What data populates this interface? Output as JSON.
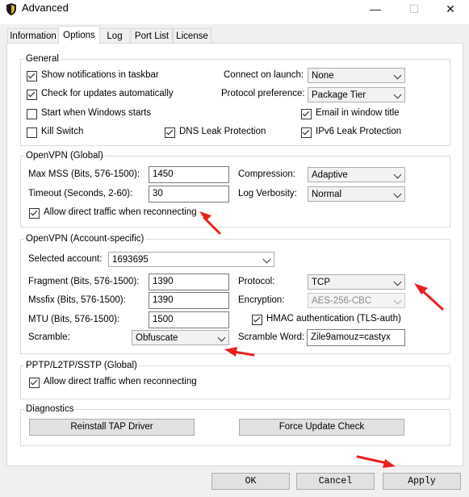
{
  "window": {
    "title": "Advanced",
    "minimize": "—",
    "maximize": "☐",
    "close": "✕"
  },
  "tabs": [
    {
      "label": "Information"
    },
    {
      "label": "Options"
    },
    {
      "label": "Log"
    },
    {
      "label": "Port List"
    },
    {
      "label": "License"
    }
  ],
  "general": {
    "legend": "General",
    "show_notifications": {
      "label": "Show notifications in taskbar",
      "checked": true
    },
    "check_updates": {
      "label": "Check for updates automatically",
      "checked": true
    },
    "start_windows": {
      "label": "Start when Windows starts",
      "checked": false
    },
    "kill_switch": {
      "label": "Kill Switch",
      "checked": false
    },
    "dns_leak": {
      "label": "DNS Leak Protection",
      "checked": true
    },
    "email_title": {
      "label": "Email in window title",
      "checked": true
    },
    "ipv6_leak": {
      "label": "IPv6 Leak Protection",
      "checked": true
    },
    "connect_on_launch": {
      "label": "Connect on launch:",
      "value": "None"
    },
    "protocol_pref": {
      "label": "Protocol preference:",
      "value": "Package Tier"
    }
  },
  "openvpn_global": {
    "legend": "OpenVPN (Global)",
    "max_mss": {
      "label": "Max MSS (Bits, 576-1500):",
      "value": "1450"
    },
    "timeout": {
      "label": "Timeout (Seconds, 2-60):",
      "value": "30"
    },
    "compression": {
      "label": "Compression:",
      "value": "Adaptive"
    },
    "log_verbosity": {
      "label": "Log Verbosity:",
      "value": "Normal"
    },
    "allow_direct": {
      "label": "Allow direct traffic when reconnecting",
      "checked": true
    }
  },
  "openvpn_account": {
    "legend": "OpenVPN (Account-specific)",
    "selected_account": {
      "label": "Selected account:",
      "value": "1693695"
    },
    "fragment": {
      "label": "Fragment (Bits, 576-1500):",
      "value": "1390"
    },
    "mssfix": {
      "label": "Mssfix (Bits, 576-1500):",
      "value": "1390"
    },
    "mtu": {
      "label": "MTU (Bits, 576-1500):",
      "value": "1500"
    },
    "scramble": {
      "label": "Scramble:",
      "value": "Obfuscate"
    },
    "protocol": {
      "label": "Protocol:",
      "value": "TCP"
    },
    "encryption": {
      "label": "Encryption:",
      "value": "AES-256-CBC"
    },
    "hmac": {
      "label": "HMAC authentication (TLS-auth)",
      "checked": true
    },
    "scramble_word": {
      "label": "Scramble Word:",
      "value": "Zile9amouz=castyx"
    }
  },
  "pptp": {
    "legend": "PPTP/L2TP/SSTP (Global)",
    "allow_direct": {
      "label": "Allow direct traffic when reconnecting",
      "checked": true
    }
  },
  "diagnostics": {
    "legend": "Diagnostics",
    "reinstall_tap": "Reinstall TAP Driver",
    "force_update": "Force Update Check"
  },
  "footer": {
    "ok": "OK",
    "cancel": "Cancel",
    "apply": "Apply"
  },
  "annotation_color": "#e8211d"
}
